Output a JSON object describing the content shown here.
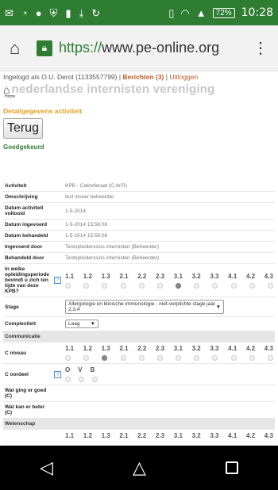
{
  "status_bar": {
    "icons": [
      "mail-icon",
      "wifi-calling-icon",
      "chat-icon",
      "shield-icon",
      "sim-icon",
      "download-icon",
      "sync-icon",
      "vibrate-icon",
      "wifi-icon",
      "signal-icon"
    ],
    "battery": "72%",
    "time": "10:28"
  },
  "browser": {
    "url_scheme": "https://",
    "url_host": "www.pe-online.org"
  },
  "header": {
    "login_prefix": "Ingelogd als O.U. Derot (1133557799) |",
    "messages": "Berichten (3)",
    "separator": "|",
    "logout": "Uitloggen",
    "org_name": "nederlandse internisten vereniging",
    "home_label": "Home"
  },
  "page": {
    "section_title": "Detailgegevens activiteit",
    "back_button": "Terug",
    "status": "Goedgekeurd"
  },
  "rows": {
    "activiteit": {
      "label": "Activiteit",
      "value": "KPB - Cat/referaat (C,W,R)"
    },
    "omschrijving": {
      "label": "Omschrijving",
      "value": "test invoer beheerder"
    },
    "datum_voltooid": {
      "label": "Datum activiteit voltooid",
      "value": "1-5-2014"
    },
    "datum_ingevoerd": {
      "label": "Datum ingevoerd",
      "value": "1-5-2014 15:56:08"
    },
    "datum_behandeld": {
      "label": "Datum behandeld",
      "value": "1-5-2014 15:56:08"
    },
    "ingevoerd_door": {
      "label": "Ingevoerd door",
      "value": "Testopleiderssios internisten (Beheerder)"
    },
    "behandeld_door": {
      "label": "Behandeld door",
      "value": "Testopleiderssios internisten (Beheerder)"
    },
    "opleidingsperiode": {
      "label": "In welke opleidingsperiode bevindt u zich ten tijde van deze KPB?"
    },
    "stage": {
      "label": "Stage",
      "value": "Allergologie en klinische immunologie - niet-verplichte stage jaar 2,3,4"
    },
    "complexiteit": {
      "label": "Complexiteit",
      "value": "Laag"
    },
    "communicatie": {
      "label": "Communicatie"
    },
    "c_niveau": {
      "label": "C niveau"
    },
    "c_oordeel": {
      "label": "C oordeel"
    },
    "goed": {
      "label": "Wat ging er goed (C)"
    },
    "beter": {
      "label": "Wat kan er beter (C)"
    },
    "wetenschap": {
      "label": "Wetenschap"
    }
  },
  "level_scale": [
    "1.1",
    "1.2",
    "1.3",
    "2.1",
    "2.2",
    "2.3",
    "3.1",
    "3.2",
    "3.3",
    "4.1",
    "4.2",
    "4.3"
  ],
  "period_selected_index": 6,
  "c_niveau_selected_index": 2,
  "oordeel_scale": [
    "O",
    "V",
    "B"
  ],
  "help_icon_text": "?"
}
